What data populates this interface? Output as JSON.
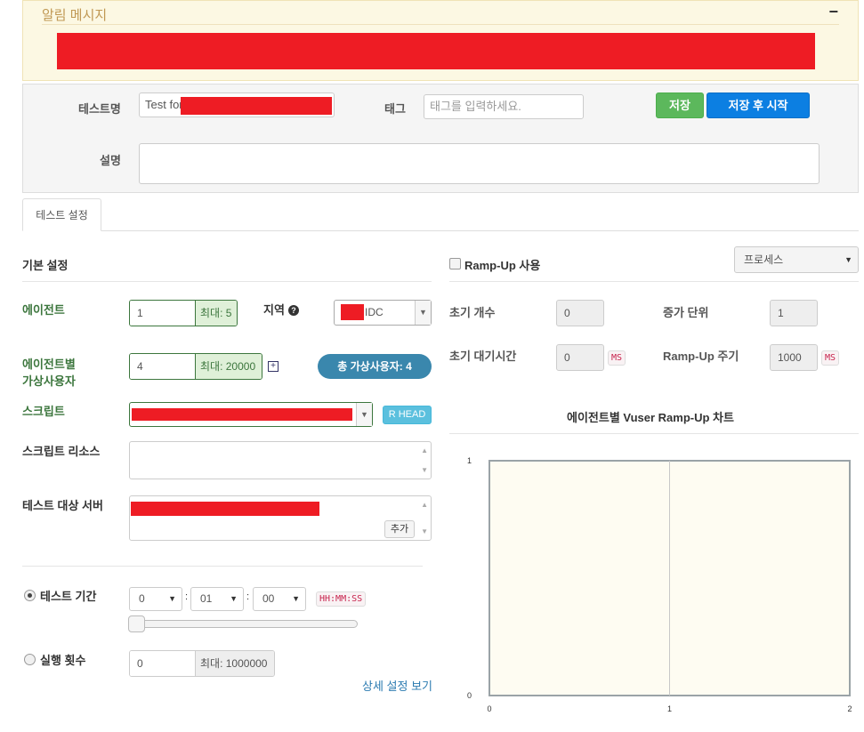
{
  "alert": {
    "title": "알림 메시지",
    "collapse_label": "−"
  },
  "meta": {
    "test_name_label": "테스트명",
    "test_name_value": "Test for",
    "tag_label": "태그",
    "tag_placeholder": "태그를 입력하세요.",
    "save_label": "저장",
    "save_start_label": "저장 후 시작",
    "description_label": "설명",
    "colors": {
      "save": "#5cb85c",
      "save_start": "#0c7fe2"
    }
  },
  "tabs": [
    {
      "label": "테스트 설정"
    }
  ],
  "basic": {
    "title": "기본 설정",
    "agent_label": "에이전트",
    "agent_value": "1",
    "agent_max": "최대: 5",
    "region_label": "지역",
    "region_help_icon": "question-circle-icon",
    "region_value": "IDC",
    "vuser_label_line1": "에이전트별",
    "vuser_label_line2": "가상사용자",
    "vuser_value": "4",
    "vuser_max": "최대: 20000",
    "vuser_expand_icon": "plus-square-icon",
    "total_vusers": "총 가상사용자: 4",
    "script_label": "스크립트",
    "script_head_button": "R HEAD",
    "script_resource_label": "스크립트 리소스",
    "target_server_label": "테스트 대상 서버",
    "target_add_button": "추가",
    "duration_label": "테스트 기간",
    "duration_hours": "0",
    "duration_minutes": "01",
    "duration_seconds": "00",
    "time_sep": ":",
    "duration_format": "HH:MM:SS",
    "duration_selected": true,
    "run_count_label": "실행 횟수",
    "run_count_value": "0",
    "run_count_max": "최대: 1000000",
    "advanced_link": "상세 설정 보기"
  },
  "rampup": {
    "enable_label": "Ramp-Up 사용",
    "enabled": false,
    "mode_value": "프로세스",
    "initial_count_label": "초기 개수",
    "initial_count_value": "0",
    "increment_label": "증가 단위",
    "increment_value": "1",
    "initial_wait_label": "초기 대기시간",
    "initial_wait_value": "0",
    "initial_wait_unit": "MS",
    "interval_label": "Ramp-Up 주기",
    "interval_value": "1000",
    "interval_unit": "MS",
    "chart_title": "에이전트별 Vuser Ramp-Up 차트"
  },
  "chart_data": {
    "type": "line",
    "title": "에이전트별 Vuser Ramp-Up 차트",
    "x": [
      0,
      1,
      2
    ],
    "xlim": [
      0,
      2
    ],
    "ylim": [
      0,
      1
    ],
    "x_ticks": [
      "0",
      "1",
      "2"
    ],
    "y_ticks": [
      "0",
      "1"
    ],
    "series": [],
    "grid": true
  }
}
